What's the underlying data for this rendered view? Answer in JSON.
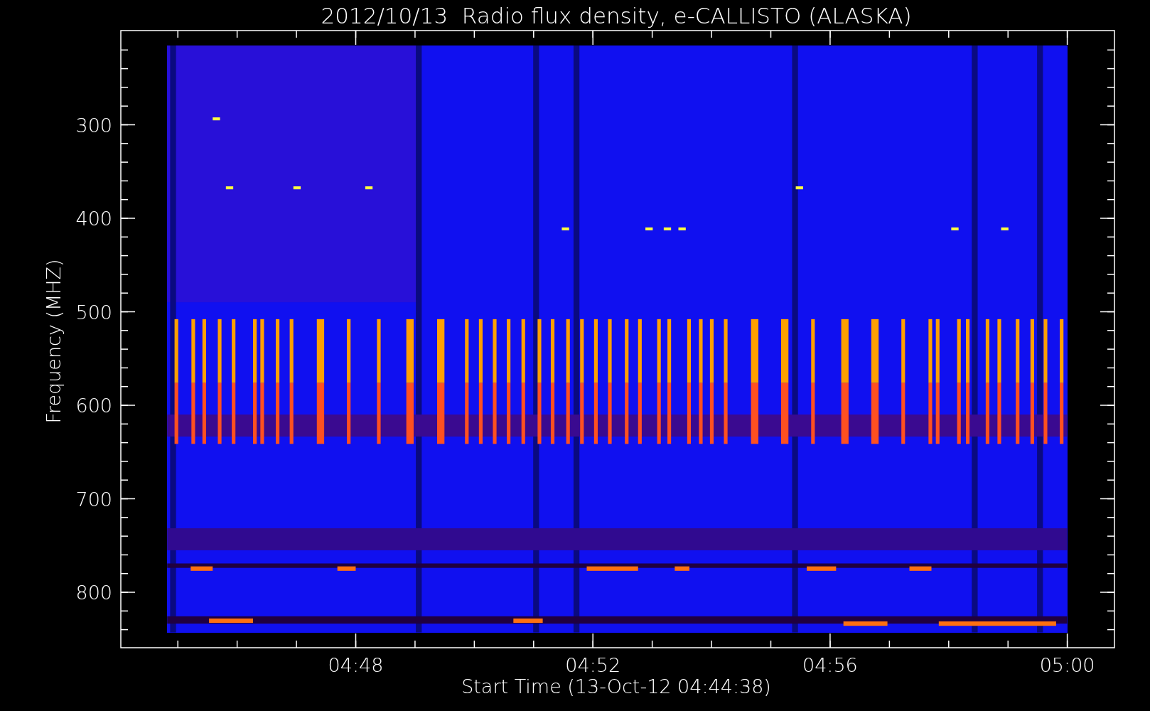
{
  "plot": {
    "title": "2012/10/13  Radio flux density, e-CALLISTO (ALASKA)",
    "ylabel": "Frequency (MHZ)",
    "xlabel": "Start Time (13-Oct-12 04:44:38)",
    "yticks": [
      "300",
      "400",
      "500",
      "600",
      "700",
      "800"
    ],
    "xticks": [
      "04:48",
      "04:52",
      "04:56",
      "05:00"
    ]
  }
}
